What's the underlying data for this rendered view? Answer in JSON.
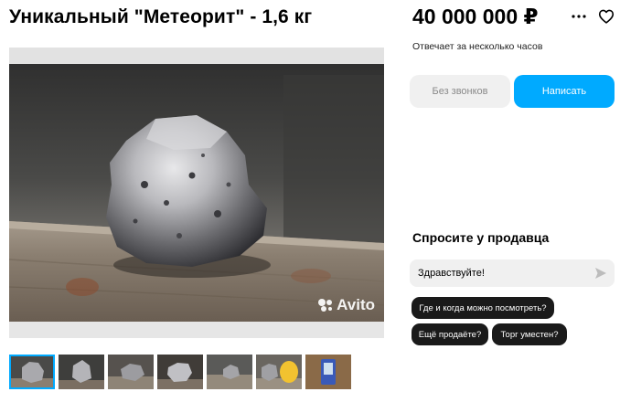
{
  "listing": {
    "title": "Уникальный \"Метеорит\" - 1,6 кг",
    "price": "40 000 000 ₽",
    "reply_time": "Отвечает за несколько часов"
  },
  "actions": {
    "no_calls_label": "Без звонков",
    "write_label": "Написать"
  },
  "icons": [
    "more-icon",
    "heart-icon",
    "send-icon",
    "avito-logo-icon"
  ],
  "ask_seller": {
    "title": "Спросите у продавца",
    "message_value": "Здравствуйте!",
    "quick_questions": [
      "Где и когда можно посмотреть?",
      "Ещё продаёте?",
      "Торг уместен?"
    ]
  },
  "photo": {
    "watermark": "Avito"
  },
  "gallery": {
    "thumbnail_count": 7,
    "active_index": 0
  },
  "colors": {
    "accent": "#00aaff",
    "button_secondary": "#f0f0f0",
    "chip_bg": "#1a1a1a"
  }
}
